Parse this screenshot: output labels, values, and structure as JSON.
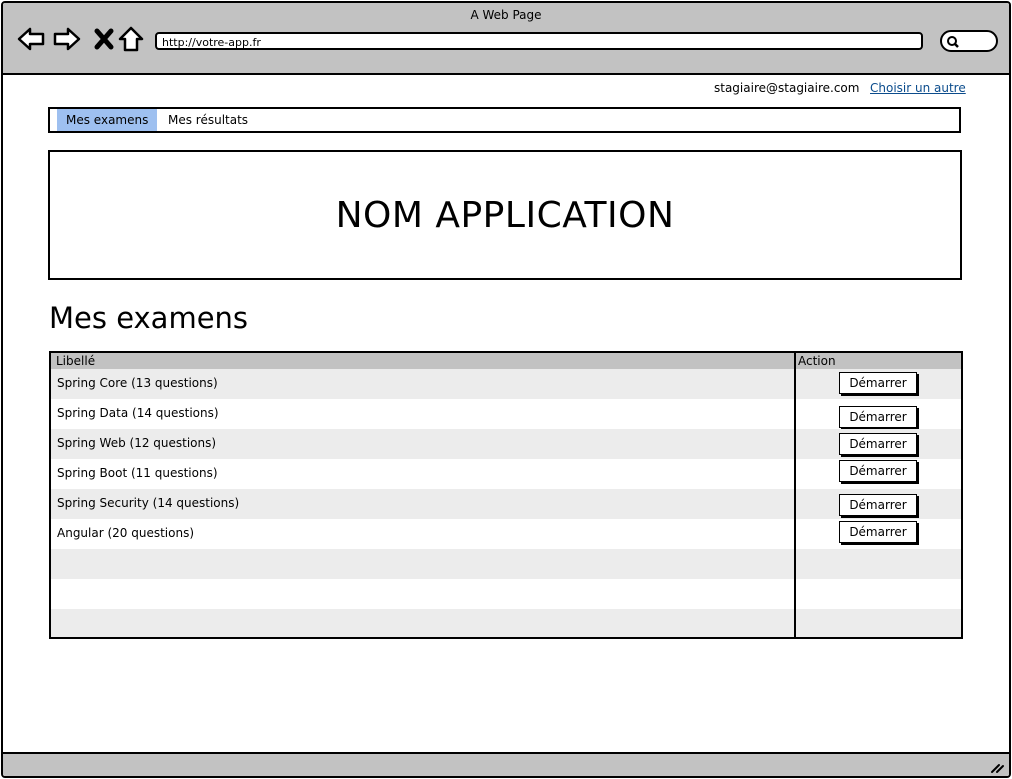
{
  "window": {
    "title": "A Web Page"
  },
  "browser": {
    "url": "http://votre-app.fr"
  },
  "user": {
    "email": "stagiaire@stagiaire.com",
    "switch_label": "Choisir un autre"
  },
  "tabs": [
    {
      "label": "Mes examens",
      "active": true
    },
    {
      "label": "Mes résultats",
      "active": false
    }
  ],
  "banner": {
    "title": "NOM APPLICATION"
  },
  "section": {
    "title": "Mes examens"
  },
  "table": {
    "columns": [
      "Libellé",
      "Action"
    ],
    "rows": [
      {
        "label": "Spring Core (13 questions)",
        "action": "Démarrer"
      },
      {
        "label": "Spring Data (14 questions)",
        "action": "Démarrer"
      },
      {
        "label": "Spring Web (12 questions)",
        "action": "Démarrer"
      },
      {
        "label": "Spring Boot (11 questions)",
        "action": "Démarrer"
      },
      {
        "label": "Spring Security (14 questions)",
        "action": "Démarrer"
      },
      {
        "label": "Angular (20 questions)",
        "action": "Démarrer"
      }
    ]
  },
  "colors": {
    "active_tab": "#9ec0f0",
    "chrome": "#c2c2c2",
    "row_alt": "#ececec",
    "link": "#0b4c8c"
  }
}
